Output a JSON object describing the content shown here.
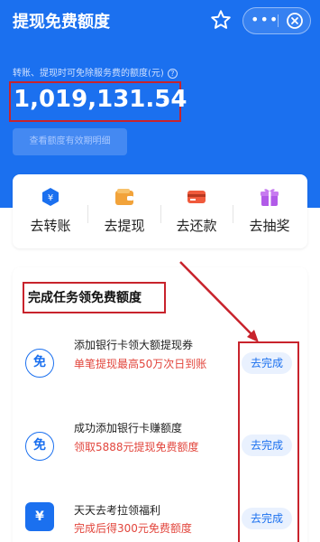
{
  "header": {
    "title": "提现免费额度",
    "more": "•••",
    "subtitle": "转账、提现时可免除服务费的额度(元)",
    "help": "?",
    "amount": "1,019,131.54",
    "amount_arrow": "›",
    "period_button": "查看额度有效期明细"
  },
  "quick_actions": [
    {
      "label": "去转账",
      "icon": "transfer-icon"
    },
    {
      "label": "去提现",
      "icon": "wallet-icon"
    },
    {
      "label": "去还款",
      "icon": "card-icon"
    },
    {
      "label": "去抽奖",
      "icon": "gift-icon"
    }
  ],
  "tasks": {
    "title": "完成任务领免费额度",
    "items": [
      {
        "icon_text": "免",
        "name": "添加银行卡领大额提现券",
        "desc": "单笔提现最高50万次日到账",
        "button": "去完成"
      },
      {
        "icon_text": "免",
        "name": "成功添加银行卡赚额度",
        "desc": "领取5888元提现免费额度",
        "button": "去完成"
      },
      {
        "icon_text": "¥",
        "name": "天天去考拉领福利",
        "desc": "完成后得300元免费额度",
        "button": "去完成"
      }
    ]
  },
  "colors": {
    "brand_blue": "#1b70ef",
    "annotation_red": "#c8232c",
    "desc_red": "#e2453c"
  }
}
